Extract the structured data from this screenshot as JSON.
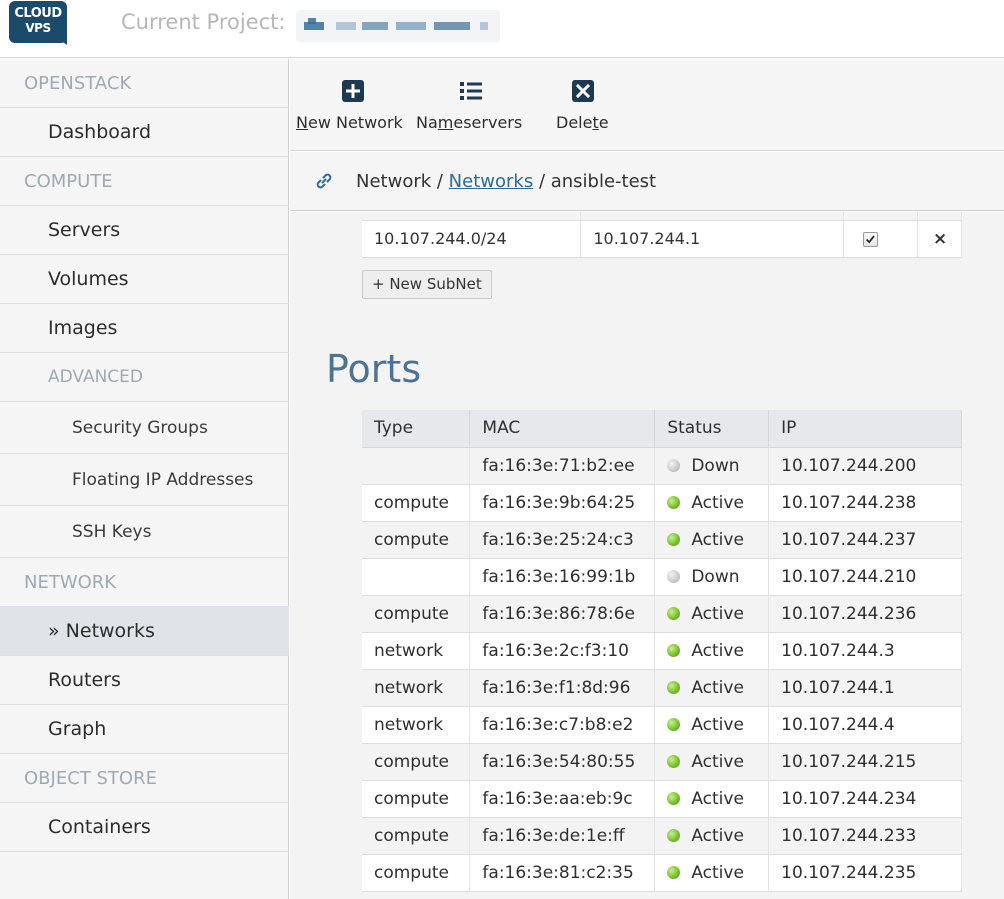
{
  "header": {
    "logo_line1": "CLOUD",
    "logo_line2": "VPS",
    "project_label": "Current Project:"
  },
  "sidebar": {
    "items": [
      {
        "kind": "section",
        "label": "OPENSTACK"
      },
      {
        "kind": "link",
        "label": "Dashboard"
      },
      {
        "kind": "section",
        "label": "COMPUTE"
      },
      {
        "kind": "link",
        "label": "Servers"
      },
      {
        "kind": "link",
        "label": "Volumes"
      },
      {
        "kind": "link",
        "label": "Images"
      },
      {
        "kind": "subsection",
        "label": "ADVANCED"
      },
      {
        "kind": "sub",
        "label": "Security Groups"
      },
      {
        "kind": "sub",
        "label": "Floating IP Addresses"
      },
      {
        "kind": "sub",
        "label": "SSH Keys"
      },
      {
        "kind": "section",
        "label": "NETWORK"
      },
      {
        "kind": "link",
        "label": "» Networks",
        "active": true
      },
      {
        "kind": "link",
        "label": "Routers"
      },
      {
        "kind": "link",
        "label": "Graph"
      },
      {
        "kind": "section",
        "label": "OBJECT STORE"
      },
      {
        "kind": "link",
        "label": "Containers"
      }
    ]
  },
  "toolbar": {
    "new_network": {
      "pre": "",
      "u": "N",
      "post": "ew Network",
      "icon": "plus-square-icon"
    },
    "nameservers": {
      "pre": "Na",
      "u": "m",
      "post": "eservers",
      "icon": "list-icon"
    },
    "delete": {
      "pre": "Dele",
      "u": "t",
      "post": "e",
      "icon": "close-square-icon"
    }
  },
  "breadcrumb": {
    "root": "Network",
    "sep1": " / ",
    "link": "Networks",
    "sep2": " / ",
    "current": "ansible-test"
  },
  "subnets": {
    "row": {
      "cidr": "10.107.244.0/24",
      "gateway": "10.107.244.1",
      "dhcp_checked": true,
      "remove_glyph": "×"
    },
    "new_button": "+ New SubNet"
  },
  "ports": {
    "title": "Ports",
    "columns": [
      "Type",
      "MAC",
      "Status",
      "IP"
    ],
    "rows": [
      {
        "type": "",
        "mac": "fa:16:3e:71:b2:ee",
        "status": "Down",
        "ip": "10.107.244.200"
      },
      {
        "type": "compute",
        "mac": "fa:16:3e:9b:64:25",
        "status": "Active",
        "ip": "10.107.244.238"
      },
      {
        "type": "compute",
        "mac": "fa:16:3e:25:24:c3",
        "status": "Active",
        "ip": "10.107.244.237"
      },
      {
        "type": "",
        "mac": "fa:16:3e:16:99:1b",
        "status": "Down",
        "ip": "10.107.244.210"
      },
      {
        "type": "compute",
        "mac": "fa:16:3e:86:78:6e",
        "status": "Active",
        "ip": "10.107.244.236"
      },
      {
        "type": "network",
        "mac": "fa:16:3e:2c:f3:10",
        "status": "Active",
        "ip": "10.107.244.3"
      },
      {
        "type": "network",
        "mac": "fa:16:3e:f1:8d:96",
        "status": "Active",
        "ip": "10.107.244.1"
      },
      {
        "type": "network",
        "mac": "fa:16:3e:c7:b8:e2",
        "status": "Active",
        "ip": "10.107.244.4"
      },
      {
        "type": "compute",
        "mac": "fa:16:3e:54:80:55",
        "status": "Active",
        "ip": "10.107.244.215"
      },
      {
        "type": "compute",
        "mac": "fa:16:3e:aa:eb:9c",
        "status": "Active",
        "ip": "10.107.244.234"
      },
      {
        "type": "compute",
        "mac": "fa:16:3e:de:1e:ff",
        "status": "Active",
        "ip": "10.107.244.233"
      },
      {
        "type": "compute",
        "mac": "fa:16:3e:81:c2:35",
        "status": "Active",
        "ip": "10.107.244.235"
      }
    ]
  },
  "colors": {
    "brand": "#1b4a6b",
    "link": "#2f6a95",
    "title": "#4f7290",
    "status_active": "#79c131",
    "status_down": "#c9c9c9"
  }
}
